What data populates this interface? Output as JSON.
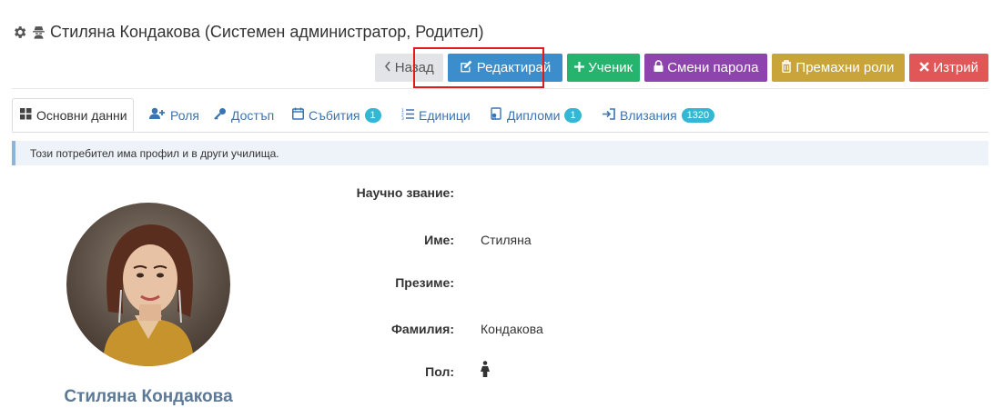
{
  "header": {
    "title": "Стиляна Кондакова (Системен администратор, Родител)"
  },
  "toolbar": {
    "back_label": "Назад",
    "edit_label": "Редактирай",
    "student_label": "Ученик",
    "change_password_label": "Смени парола",
    "remove_roles_label": "Премахни роли",
    "delete_label": "Изтрий"
  },
  "tabs": [
    {
      "label": "Основни данни",
      "icon": "grid-icon"
    },
    {
      "label": "Роля",
      "icon": "user-plus-icon"
    },
    {
      "label": "Достъп",
      "icon": "key-icon"
    },
    {
      "label": "Събития",
      "icon": "calendar-icon",
      "badge": "1"
    },
    {
      "label": "Единици",
      "icon": "list-ol-icon"
    },
    {
      "label": "Дипломи",
      "icon": "certificate-icon",
      "badge": "1"
    },
    {
      "label": "Влизания",
      "icon": "sign-in-icon",
      "badge": "1320"
    }
  ],
  "alert": {
    "text": "Този потребител има профил и в други училища."
  },
  "profile": {
    "name": "Стиляна Кондакова"
  },
  "fields": [
    {
      "label": "Научно звание:",
      "value": ""
    },
    {
      "label": "Име:",
      "value": "Стиляна"
    },
    {
      "label": "Презиме:",
      "value": ""
    },
    {
      "label": "Фамилия:",
      "value": "Кондакова"
    },
    {
      "label": "Пол:",
      "value": ""
    }
  ],
  "colors": {
    "primary": "#3c8dcc",
    "success": "#26b36d",
    "purple": "#8e44ad",
    "warning": "#c9a43a",
    "danger": "#e15757",
    "highlight": "#e01b1b"
  }
}
